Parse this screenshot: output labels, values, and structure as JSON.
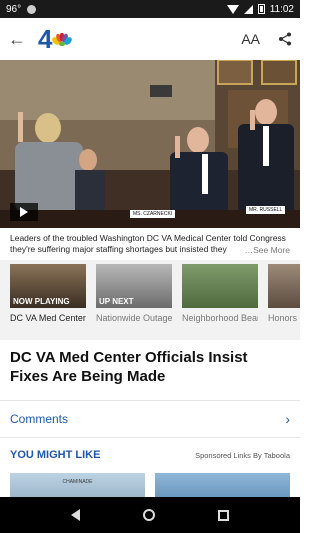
{
  "status_bar": {
    "temperature": "96°",
    "time": "11:02"
  },
  "app_bar": {
    "logo_number": "4",
    "text_size_label": "AA"
  },
  "hero": {
    "nameplates": [
      "MS. CZARNECKI",
      "MR. RUSSELL"
    ],
    "caption": "Leaders of the troubled Washington DC VA Medical Center told Congress they're suffering major staffing shortages but insisted they",
    "see_more": "…See More"
  },
  "video_strip": [
    {
      "badge": "NOW PLAYING",
      "title": "DC VA Med Center Officials Insist F..."
    },
    {
      "badge": "UP NEXT",
      "title": "Nationwide Outage Disrupts ..."
    },
    {
      "badge": "",
      "title": "Neighborhood Bear Spooks Nei..."
    },
    {
      "badge": "",
      "title": "Honors Killed in ..."
    }
  ],
  "article": {
    "headline": "DC VA Med Center Officials Insist Fixes Are Being Made"
  },
  "comments": {
    "label": "Comments"
  },
  "you_might_like": {
    "title": "YOU MIGHT LIKE",
    "sponsored": "Sponsored Links By Taboola",
    "thumb_text": "CHAMINADE"
  },
  "colors": {
    "accent": "#1f57a8",
    "status_bar": "#1a1a1a",
    "strip_bg": "#f2f2f2"
  },
  "icons": [
    "back-arrow-icon",
    "nbc-peacock-icon",
    "text-size-icon",
    "share-icon",
    "play-icon"
  ]
}
